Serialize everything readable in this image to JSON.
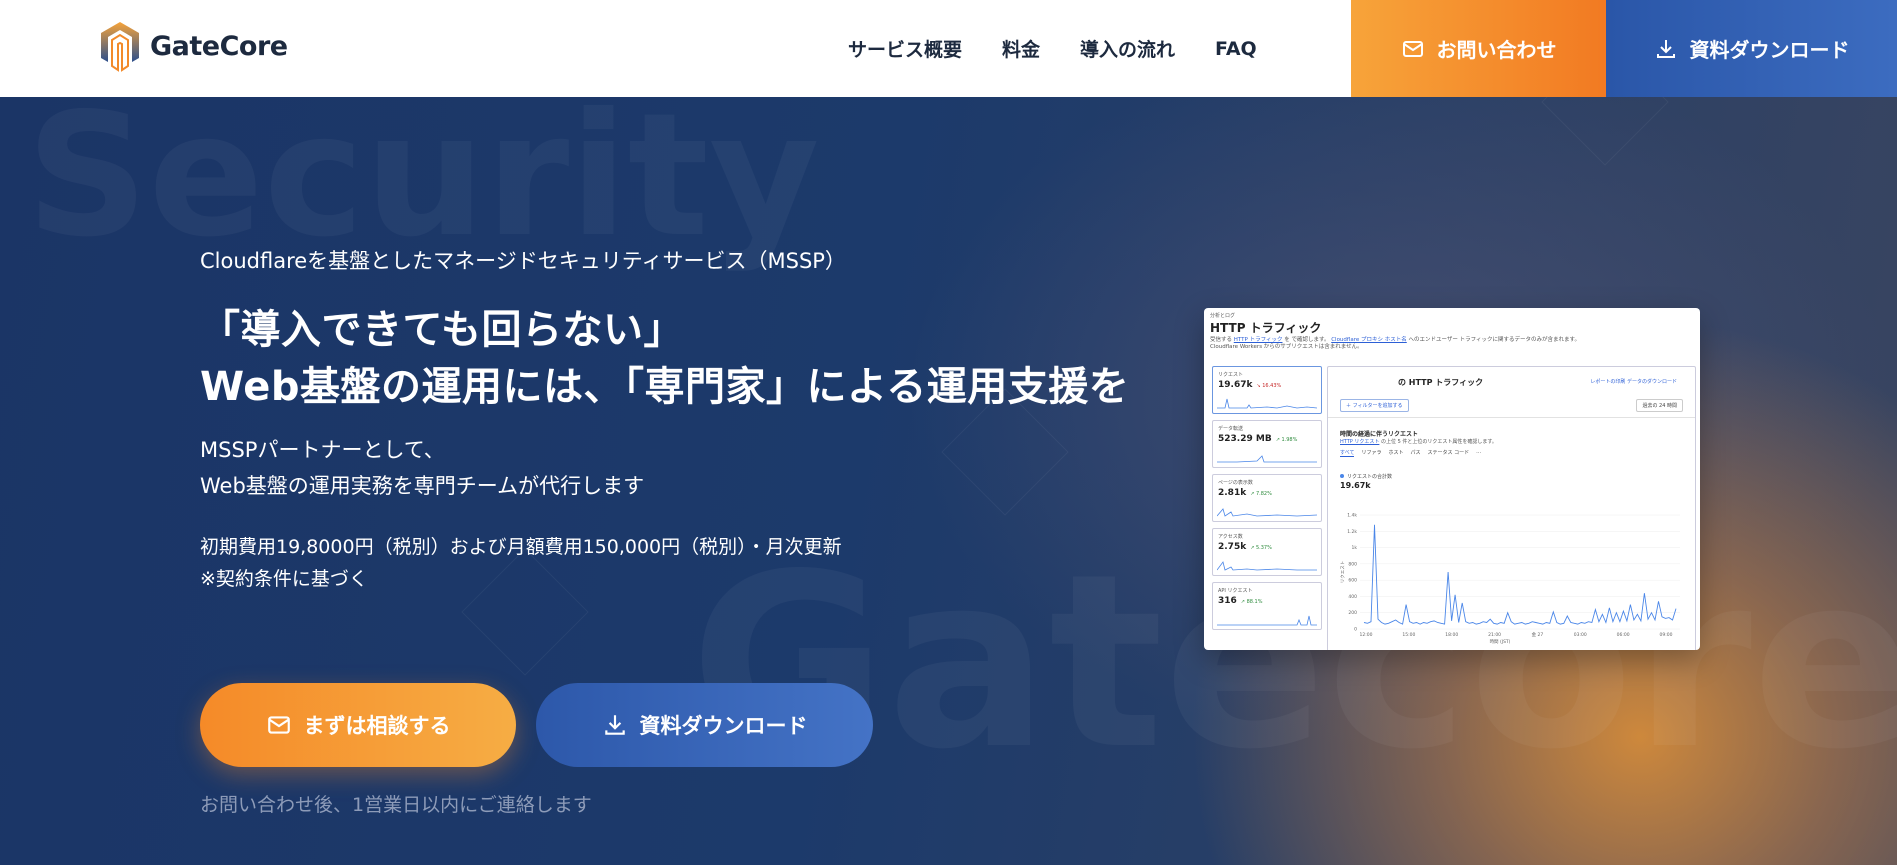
{
  "header": {
    "brand": "GateCore",
    "nav": [
      "サービス概要",
      "料金",
      "導入の流れ",
      "FAQ"
    ],
    "contact_label": "お問い合わせ",
    "download_label": "資料ダウンロード"
  },
  "hero": {
    "bg_word_top": "Security",
    "bg_word_bottom": "Gatecore",
    "subtitle": "Cloudflareを基盤としたマネージドセキュリティサービス（MSSP）",
    "headline_line1": "「導入できても回らない」",
    "headline_line2": "Web基盤の運用には、「専門家」による運用支援を",
    "desc_line1": "MSSPパートナーとして、",
    "desc_line2": "Web基盤の運用実務を専門チームが代行します",
    "fee_line1": "初期費用19,8000円（税別）および月額費用150,000円（税別）・月次更新",
    "fee_line2": "※契約条件に基づく",
    "consult_button": "まずは相談する",
    "download_button": "資料ダウンロード",
    "note": "お問い合わせ後、1営業日以内にご連絡します"
  },
  "dashboard": {
    "crumb": "分析とログ",
    "title": "HTTP トラフィック",
    "desc_a": "受信する",
    "desc_link1": "HTTP トラフィック",
    "desc_b": "を",
    "desc_c": "で確認します。",
    "desc_link2": "Cloudflare プロキシ ホスト名",
    "desc_d": "へのエンドユーザー トラフィックに関するデータのみが含まれます。",
    "desc_e": "Cloudflare Workers からのサブリクエストは含まれません。",
    "cards": [
      {
        "label": "リクエスト",
        "value": "19.67k",
        "change": "↘ 16.43%",
        "trend": "down"
      },
      {
        "label": "データ転送",
        "value": "523.29 MB",
        "change": "↗ 1.98%",
        "trend": "up"
      },
      {
        "label": "ページの表示数",
        "value": "2.81k",
        "change": "↗ 7.82%",
        "trend": "up"
      },
      {
        "label": "アクセス数",
        "value": "2.75k",
        "change": "↗ 5.37%",
        "trend": "up"
      },
      {
        "label": "API リクエスト",
        "value": "316",
        "change": "↗ 88.1%",
        "trend": "up"
      }
    ],
    "panel_title": "の HTTP トラフィック",
    "panel_links": "レポートの印刷  データのダウンロード",
    "filter_button": "＋ フィルターを追加する",
    "range": "過去の 24 時間",
    "section_title": "時間の経過に伴うリクエスト",
    "section_link": "HTTP リクエスト",
    "section_sub": "の上位 5 件と上位のリクエスト属性を確認します。",
    "tabs": [
      "すべて",
      "リファラ",
      "ホスト",
      "パス",
      "ステータス コード",
      "…"
    ],
    "legend": "リクエストの合計数",
    "total": "19.67k",
    "y_label": "リクエスト",
    "x_title": "時間 (JST)"
  },
  "chart_data": {
    "type": "line",
    "title": "",
    "xlabel": "時間 (JST)",
    "ylabel": "リクエスト",
    "x_ticks": [
      "12:00",
      "15:00",
      "18:00",
      "21:00",
      "金 27",
      "03:00",
      "06:00",
      "09:00"
    ],
    "y_ticks": [
      "0",
      "200",
      "400",
      "600",
      "800",
      "1k",
      "1.2k",
      "1.4k"
    ],
    "ylim": [
      0,
      1400
    ],
    "series": [
      {
        "values": [
          80,
          70,
          90,
          1280,
          120,
          80,
          60,
          70,
          90,
          110,
          80,
          60,
          300,
          90,
          70,
          80,
          60,
          80,
          70,
          90,
          100,
          80,
          70,
          60,
          700,
          100,
          420,
          80,
          320,
          90,
          70,
          80,
          60,
          70,
          90,
          80,
          120,
          70,
          60,
          80,
          70,
          200,
          90,
          60,
          70,
          80,
          60,
          70,
          90,
          80,
          70,
          60,
          80,
          70,
          210,
          80,
          60,
          70,
          160,
          80,
          70,
          60,
          80,
          70,
          90,
          80,
          240,
          90,
          180,
          80,
          260,
          90,
          200,
          90,
          220,
          100,
          300,
          110,
          180,
          100,
          440,
          120,
          200,
          110,
          340,
          150,
          130,
          140,
          110,
          250
        ]
      }
    ]
  }
}
